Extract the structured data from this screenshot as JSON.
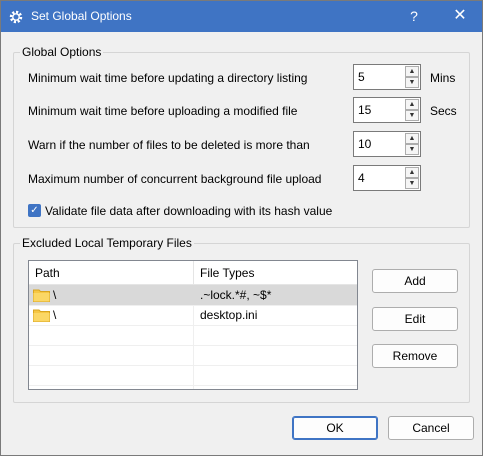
{
  "window": {
    "title": "Set Global Options",
    "help_glyph": "?",
    "close_glyph": "✕"
  },
  "global_options": {
    "group_label": "Global Options",
    "options": [
      {
        "label": "Minimum wait time before updating a directory listing",
        "value": "5",
        "unit": "Mins"
      },
      {
        "label": "Minimum wait time before uploading a modified file",
        "value": "15",
        "unit": "Secs"
      },
      {
        "label": "Warn if the number of files to be deleted is more than",
        "value": "10",
        "unit": ""
      },
      {
        "label": "Maximum number of concurrent background file upload",
        "value": "4",
        "unit": ""
      }
    ],
    "validate_checkbox": {
      "label": "Validate file data after downloading with its hash value",
      "checked": true
    }
  },
  "excluded": {
    "group_label": "Excluded Local Temporary Files",
    "columns": [
      "Path",
      "File Types"
    ],
    "rows": [
      {
        "path": "\\",
        "types": ".~lock.*#, ~$*",
        "selected": true
      },
      {
        "path": "\\",
        "types": "desktop.ini",
        "selected": false
      }
    ],
    "buttons": {
      "add": "Add",
      "edit": "Edit",
      "remove": "Remove"
    }
  },
  "footer": {
    "ok": "OK",
    "cancel": "Cancel"
  },
  "colors": {
    "titlebar": "#3f74c4",
    "selected_row": "#d9d9d9",
    "folder": "#f6c744"
  },
  "icons": {
    "window": "gear-icon",
    "row": "folder-icon",
    "spin_up": "▲",
    "spin_down": "▼",
    "check": "✓"
  }
}
